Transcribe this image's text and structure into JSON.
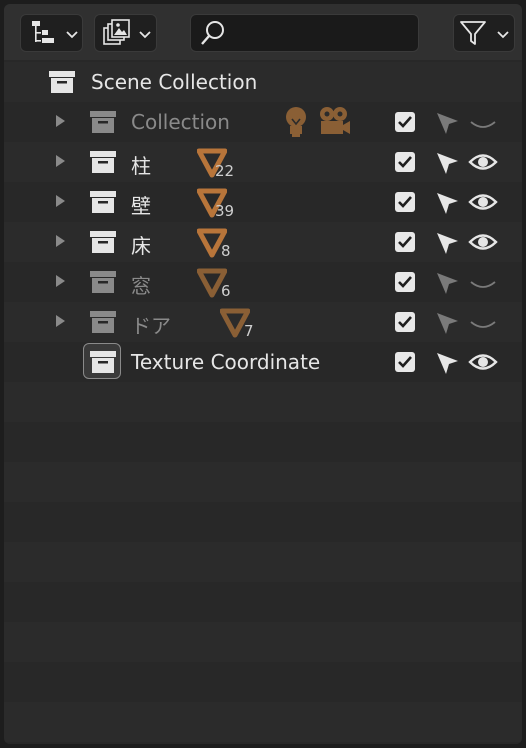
{
  "header": {
    "display_mode_icon": "outliner-tree-icon",
    "filter_icon": "funnel-icon",
    "search": {
      "value": "",
      "placeholder": ""
    }
  },
  "outliner": {
    "root": {
      "label": "Scene Collection",
      "icon": "collection-box-icon"
    },
    "items": [
      {
        "label": "Collection",
        "dimmed": true,
        "decor": [
          "lightbulb-icon",
          "camera-icon"
        ],
        "count": "",
        "checked": true,
        "selectable": "dim",
        "visible": "hidden"
      },
      {
        "label": "柱",
        "dimmed": false,
        "decor": [
          "mesh-triangle-icon"
        ],
        "count": "22",
        "checked": true,
        "selectable": "on",
        "visible": "visible"
      },
      {
        "label": "壁",
        "dimmed": false,
        "decor": [
          "mesh-triangle-icon"
        ],
        "count": "39",
        "checked": true,
        "selectable": "on",
        "visible": "visible"
      },
      {
        "label": "床",
        "dimmed": false,
        "decor": [
          "mesh-triangle-icon"
        ],
        "count": "8",
        "checked": true,
        "selectable": "on",
        "visible": "visible"
      },
      {
        "label": "窓",
        "dimmed": true,
        "decor": [
          "mesh-triangle-icon"
        ],
        "count": "6",
        "checked": true,
        "selectable": "dim",
        "visible": "hidden"
      },
      {
        "label": "ドア",
        "dimmed": true,
        "decor": [
          "mesh-triangle-icon"
        ],
        "count": "7",
        "checked": true,
        "selectable": "dim",
        "visible": "hidden"
      },
      {
        "label": "Texture Coordinate",
        "dimmed": false,
        "decor": [],
        "count": "",
        "checked": true,
        "selectable": "on",
        "visible": "visible",
        "active": true
      }
    ]
  },
  "colors": {
    "accent_orange": "#b8753a",
    "text": "#e6e6e6",
    "dim_text": "#8a8a8a"
  }
}
